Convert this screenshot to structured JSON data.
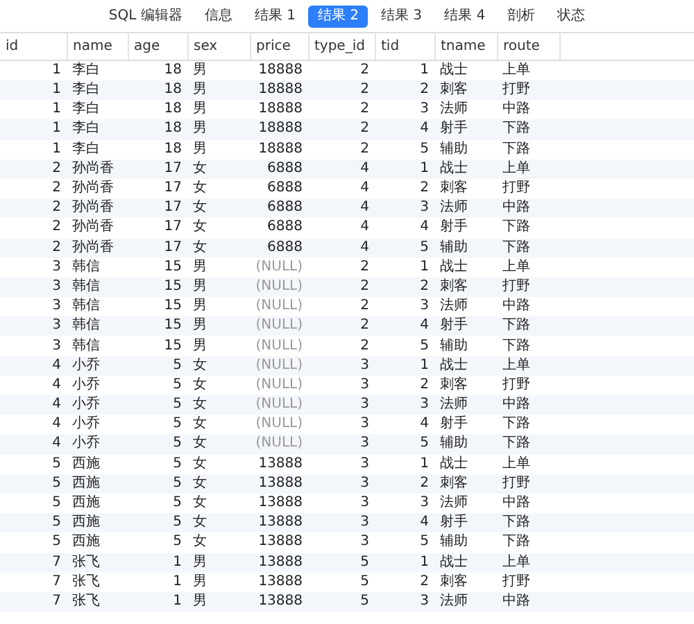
{
  "tabs": [
    {
      "label": "SQL 编辑器",
      "selected": false
    },
    {
      "label": "信息",
      "selected": false
    },
    {
      "label": "结果 1",
      "selected": false
    },
    {
      "label": "结果 2",
      "selected": true
    },
    {
      "label": "结果 3",
      "selected": false
    },
    {
      "label": "结果 4",
      "selected": false
    },
    {
      "label": "剖析",
      "selected": false
    },
    {
      "label": "状态",
      "selected": false
    }
  ],
  "table": {
    "columns": [
      "id",
      "name",
      "age",
      "sex",
      "price",
      "type_id",
      "tid",
      "tname",
      "route"
    ],
    "rows": [
      {
        "id": "1",
        "name": "李白",
        "age": "18",
        "sex": "男",
        "price": "18888",
        "price_null": false,
        "type_id": "2",
        "tid": "1",
        "tname": "战士",
        "route": "上单"
      },
      {
        "id": "1",
        "name": "李白",
        "age": "18",
        "sex": "男",
        "price": "18888",
        "price_null": false,
        "type_id": "2",
        "tid": "2",
        "tname": "刺客",
        "route": "打野"
      },
      {
        "id": "1",
        "name": "李白",
        "age": "18",
        "sex": "男",
        "price": "18888",
        "price_null": false,
        "type_id": "2",
        "tid": "3",
        "tname": "法师",
        "route": "中路"
      },
      {
        "id": "1",
        "name": "李白",
        "age": "18",
        "sex": "男",
        "price": "18888",
        "price_null": false,
        "type_id": "2",
        "tid": "4",
        "tname": "射手",
        "route": "下路"
      },
      {
        "id": "1",
        "name": "李白",
        "age": "18",
        "sex": "男",
        "price": "18888",
        "price_null": false,
        "type_id": "2",
        "tid": "5",
        "tname": "辅助",
        "route": "下路"
      },
      {
        "id": "2",
        "name": "孙尚香",
        "age": "17",
        "sex": "女",
        "price": "6888",
        "price_null": false,
        "type_id": "4",
        "tid": "1",
        "tname": "战士",
        "route": "上单"
      },
      {
        "id": "2",
        "name": "孙尚香",
        "age": "17",
        "sex": "女",
        "price": "6888",
        "price_null": false,
        "type_id": "4",
        "tid": "2",
        "tname": "刺客",
        "route": "打野"
      },
      {
        "id": "2",
        "name": "孙尚香",
        "age": "17",
        "sex": "女",
        "price": "6888",
        "price_null": false,
        "type_id": "4",
        "tid": "3",
        "tname": "法师",
        "route": "中路"
      },
      {
        "id": "2",
        "name": "孙尚香",
        "age": "17",
        "sex": "女",
        "price": "6888",
        "price_null": false,
        "type_id": "4",
        "tid": "4",
        "tname": "射手",
        "route": "下路"
      },
      {
        "id": "2",
        "name": "孙尚香",
        "age": "17",
        "sex": "女",
        "price": "6888",
        "price_null": false,
        "type_id": "4",
        "tid": "5",
        "tname": "辅助",
        "route": "下路"
      },
      {
        "id": "3",
        "name": "韩信",
        "age": "15",
        "sex": "男",
        "price": "(NULL)",
        "price_null": true,
        "type_id": "2",
        "tid": "1",
        "tname": "战士",
        "route": "上单"
      },
      {
        "id": "3",
        "name": "韩信",
        "age": "15",
        "sex": "男",
        "price": "(NULL)",
        "price_null": true,
        "type_id": "2",
        "tid": "2",
        "tname": "刺客",
        "route": "打野"
      },
      {
        "id": "3",
        "name": "韩信",
        "age": "15",
        "sex": "男",
        "price": "(NULL)",
        "price_null": true,
        "type_id": "2",
        "tid": "3",
        "tname": "法师",
        "route": "中路"
      },
      {
        "id": "3",
        "name": "韩信",
        "age": "15",
        "sex": "男",
        "price": "(NULL)",
        "price_null": true,
        "type_id": "2",
        "tid": "4",
        "tname": "射手",
        "route": "下路"
      },
      {
        "id": "3",
        "name": "韩信",
        "age": "15",
        "sex": "男",
        "price": "(NULL)",
        "price_null": true,
        "type_id": "2",
        "tid": "5",
        "tname": "辅助",
        "route": "下路"
      },
      {
        "id": "4",
        "name": "小乔",
        "age": "5",
        "sex": "女",
        "price": "(NULL)",
        "price_null": true,
        "type_id": "3",
        "tid": "1",
        "tname": "战士",
        "route": "上单"
      },
      {
        "id": "4",
        "name": "小乔",
        "age": "5",
        "sex": "女",
        "price": "(NULL)",
        "price_null": true,
        "type_id": "3",
        "tid": "2",
        "tname": "刺客",
        "route": "打野"
      },
      {
        "id": "4",
        "name": "小乔",
        "age": "5",
        "sex": "女",
        "price": "(NULL)",
        "price_null": true,
        "type_id": "3",
        "tid": "3",
        "tname": "法师",
        "route": "中路"
      },
      {
        "id": "4",
        "name": "小乔",
        "age": "5",
        "sex": "女",
        "price": "(NULL)",
        "price_null": true,
        "type_id": "3",
        "tid": "4",
        "tname": "射手",
        "route": "下路"
      },
      {
        "id": "4",
        "name": "小乔",
        "age": "5",
        "sex": "女",
        "price": "(NULL)",
        "price_null": true,
        "type_id": "3",
        "tid": "5",
        "tname": "辅助",
        "route": "下路"
      },
      {
        "id": "5",
        "name": "西施",
        "age": "5",
        "sex": "女",
        "price": "13888",
        "price_null": false,
        "type_id": "3",
        "tid": "1",
        "tname": "战士",
        "route": "上单"
      },
      {
        "id": "5",
        "name": "西施",
        "age": "5",
        "sex": "女",
        "price": "13888",
        "price_null": false,
        "type_id": "3",
        "tid": "2",
        "tname": "刺客",
        "route": "打野"
      },
      {
        "id": "5",
        "name": "西施",
        "age": "5",
        "sex": "女",
        "price": "13888",
        "price_null": false,
        "type_id": "3",
        "tid": "3",
        "tname": "法师",
        "route": "中路"
      },
      {
        "id": "5",
        "name": "西施",
        "age": "5",
        "sex": "女",
        "price": "13888",
        "price_null": false,
        "type_id": "3",
        "tid": "4",
        "tname": "射手",
        "route": "下路"
      },
      {
        "id": "5",
        "name": "西施",
        "age": "5",
        "sex": "女",
        "price": "13888",
        "price_null": false,
        "type_id": "3",
        "tid": "5",
        "tname": "辅助",
        "route": "下路"
      },
      {
        "id": "7",
        "name": "张飞",
        "age": "1",
        "sex": "男",
        "price": "13888",
        "price_null": false,
        "type_id": "5",
        "tid": "1",
        "tname": "战士",
        "route": "上单"
      },
      {
        "id": "7",
        "name": "张飞",
        "age": "1",
        "sex": "男",
        "price": "13888",
        "price_null": false,
        "type_id": "5",
        "tid": "2",
        "tname": "刺客",
        "route": "打野"
      },
      {
        "id": "7",
        "name": "张飞",
        "age": "1",
        "sex": "男",
        "price": "13888",
        "price_null": false,
        "type_id": "5",
        "tid": "3",
        "tname": "法师",
        "route": "中路"
      }
    ]
  }
}
